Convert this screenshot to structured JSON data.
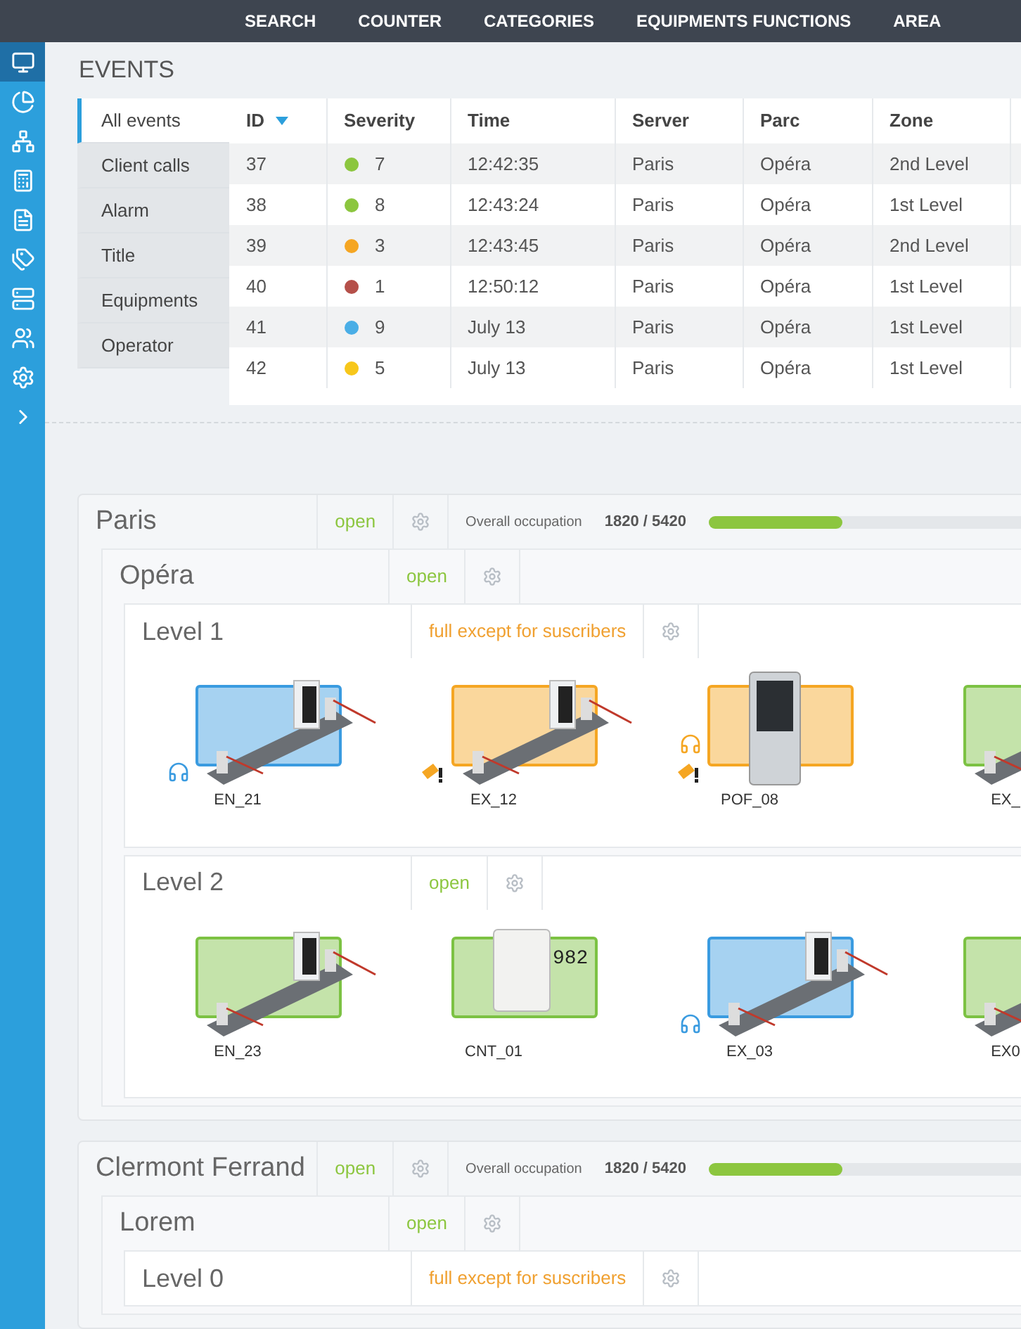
{
  "nav": {
    "items": [
      "SEARCH",
      "COUNTER",
      "CATEGORIES",
      "EQUIPMENTS FUNCTIONS",
      "AREA"
    ]
  },
  "sidebar": {
    "items": [
      {
        "kind": "monitor",
        "selected": true
      },
      {
        "kind": "chart",
        "selected": false
      },
      {
        "kind": "network",
        "selected": false
      },
      {
        "kind": "calculator",
        "selected": false
      },
      {
        "kind": "document",
        "selected": false
      },
      {
        "kind": "tags",
        "selected": false
      },
      {
        "kind": "server",
        "selected": false
      },
      {
        "kind": "users",
        "selected": false
      },
      {
        "kind": "settings",
        "selected": false
      },
      {
        "kind": "expand",
        "selected": false
      }
    ]
  },
  "events": {
    "title": "EVENTS",
    "tabs": [
      {
        "label": "All events",
        "selected": true
      },
      {
        "label": "Client calls",
        "selected": false
      },
      {
        "label": "Alarm",
        "selected": false
      },
      {
        "label": "Title",
        "selected": false
      },
      {
        "label": "Equipments",
        "selected": false
      },
      {
        "label": "Operator",
        "selected": false
      }
    ],
    "table": {
      "columns": [
        {
          "label": "ID",
          "sorted": true
        },
        {
          "label": "Severity",
          "sorted": false
        },
        {
          "label": "Time",
          "sorted": false
        },
        {
          "label": "Server",
          "sorted": false
        },
        {
          "label": "Parc",
          "sorted": false
        },
        {
          "label": "Zone",
          "sorted": false
        }
      ],
      "rows": [
        {
          "id": "37",
          "color": "#8cc63f",
          "severity": "7",
          "time": "12:42:35",
          "server": "Paris",
          "parc": "Opéra",
          "zone": "2nd Level"
        },
        {
          "id": "38",
          "color": "#8cc63f",
          "severity": "8",
          "time": "12:43:24",
          "server": "Paris",
          "parc": "Opéra",
          "zone": "1st Level"
        },
        {
          "id": "39",
          "color": "#f5a623",
          "severity": "3",
          "time": "12:43:45",
          "server": "Paris",
          "parc": "Opéra",
          "zone": "2nd Level"
        },
        {
          "id": "40",
          "color": "#b5504a",
          "severity": "1",
          "time": "12:50:12",
          "server": "Paris",
          "parc": "Opéra",
          "zone": "1st Level"
        },
        {
          "id": "41",
          "color": "#4aaee6",
          "severity": "9",
          "time": "July 13",
          "server": "Paris",
          "parc": "Opéra",
          "zone": "1st Level"
        },
        {
          "id": "42",
          "color": "#f7c71b",
          "severity": "5",
          "time": "July 13",
          "server": "Paris",
          "parc": "Opéra",
          "zone": "1st Level"
        }
      ]
    }
  },
  "sites": [
    {
      "name": "Paris",
      "status": {
        "kind": "open",
        "text": "open"
      },
      "occupation": {
        "label": "Overall occupation",
        "count": "1820 / 5420",
        "level": 0.34
      },
      "parcs": [
        {
          "name": "Opéra",
          "status": {
            "kind": "open",
            "text": "open"
          },
          "levels": [
            {
              "name": "Level 1",
              "status": {
                "kind": "full",
                "text": "full except for suscribers"
              },
              "equipments": [
                {
                  "label": "EN_21",
                  "kind": "gate",
                  "color": "#3a9be0",
                  "headset": true,
                  "alert": false
                },
                {
                  "label": "EX_12",
                  "kind": "gate",
                  "color": "#f5a623",
                  "headset": false,
                  "alert": true
                },
                {
                  "label": "POF_08",
                  "kind": "kiosk",
                  "color": "#f5a623",
                  "headset": true,
                  "alert": true
                },
                {
                  "label": "EX_",
                  "kind": "gate",
                  "color": "#7cc243",
                  "headset": false,
                  "alert": false
                }
              ]
            },
            {
              "name": "Level 2",
              "status": {
                "kind": "open",
                "text": "open"
              },
              "equipments": [
                {
                  "label": "EN_23",
                  "kind": "gate",
                  "color": "#7cc243",
                  "headset": false,
                  "alert": false
                },
                {
                  "label": "CNT_01",
                  "kind": "counter",
                  "color": "#7cc243",
                  "reading": "982",
                  "headset": false,
                  "alert": false
                },
                {
                  "label": "EX_03",
                  "kind": "gate",
                  "color": "#3a9be0",
                  "headset": true,
                  "alert": false
                },
                {
                  "label": "EX0",
                  "kind": "gate",
                  "color": "#7cc243",
                  "headset": false,
                  "alert": false
                }
              ]
            }
          ]
        }
      ]
    },
    {
      "name": "Clermont Ferrand",
      "status": {
        "kind": "open",
        "text": "open"
      },
      "occupation": {
        "label": "Overall occupation",
        "count": "1820 / 5420",
        "level": 0.34
      },
      "parcs": [
        {
          "name": "Lorem",
          "status": {
            "kind": "open",
            "text": "open"
          },
          "levels": [
            {
              "name": "Level 0",
              "status": {
                "kind": "full",
                "text": "full except for suscribers"
              }
            }
          ]
        }
      ]
    }
  ]
}
